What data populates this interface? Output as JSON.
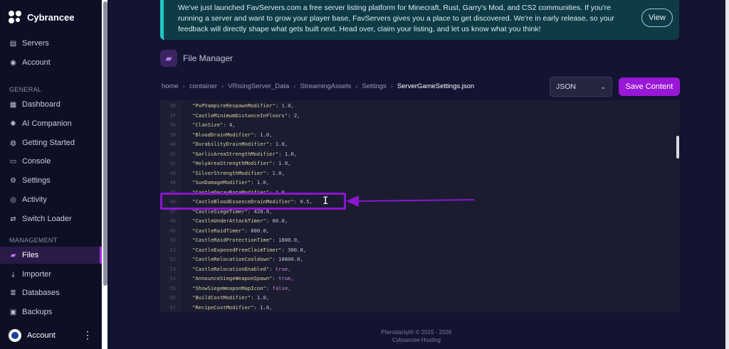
{
  "brand": {
    "name": "Cybrancee"
  },
  "sidebar": {
    "top_items": [
      {
        "label": "Servers",
        "icon": "server-icon"
      },
      {
        "label": "Account",
        "icon": "user-circle-icon"
      }
    ],
    "general_label": "GENERAL",
    "general_items": [
      {
        "label": "Dashboard",
        "icon": "dashboard-icon"
      },
      {
        "label": "AI Companion",
        "icon": "ai-icon"
      },
      {
        "label": "Getting Started",
        "icon": "globe-icon"
      },
      {
        "label": "Console",
        "icon": "console-icon"
      },
      {
        "label": "Settings",
        "icon": "gear-icon"
      },
      {
        "label": "Activity",
        "icon": "eye-icon"
      },
      {
        "label": "Switch Loader",
        "icon": "switch-icon"
      }
    ],
    "management_label": "MANAGEMENT",
    "management_items": [
      {
        "label": "Files",
        "icon": "folder-icon",
        "active": true
      },
      {
        "label": "Importer",
        "icon": "download-icon"
      },
      {
        "label": "Databases",
        "icon": "database-icon"
      },
      {
        "label": "Backups",
        "icon": "archive-icon"
      }
    ],
    "account_label": "Account"
  },
  "banner": {
    "text": "We've just launched FavServers.com a free server listing platform for Minecraft, Rust, Garry's Mod, and CS2 communities. If you're running a server and want to grow your player base, FavServers gives you a place to get discovered. We're in early release, so your feedback will directly shape what gets built next. Head over, claim your listing, and let us know what you think!",
    "button_label": "View"
  },
  "file_manager": {
    "title": "File Manager",
    "breadcrumb": [
      "home",
      "container",
      "VRisingServer_Data",
      "StreamingAssets",
      "Settings",
      "ServerGameSettings.json"
    ],
    "language_select": "JSON",
    "save_label": "Save Content"
  },
  "editor": {
    "lines": [
      {
        "num": "36",
        "key": "\"PvPVampireRespawnModifier\"",
        "val": "1.0,"
      },
      {
        "num": "37",
        "key": "\"CastleMinimumDistanceInFloors\"",
        "val": "2,"
      },
      {
        "num": "38",
        "key": "\"ClanSize\"",
        "val": "4,"
      },
      {
        "num": "39",
        "key": "\"BloodDrainModifier\"",
        "val": "1.0,"
      },
      {
        "num": "40",
        "key": "\"DurabilityDrainModifier\"",
        "val": "1.0,"
      },
      {
        "num": "41",
        "key": "\"GarlicAreaStrengthModifier\"",
        "val": "1.0,"
      },
      {
        "num": "42",
        "key": "\"HolyAreaStrengthModifier\"",
        "val": "1.0,"
      },
      {
        "num": "43",
        "key": "\"SilverStrengthModifier\"",
        "val": "1.0,"
      },
      {
        "num": "44",
        "key": "\"SunDamageModifier\"",
        "val": "1.0,"
      },
      {
        "num": "45",
        "key": "\"CastleDecayRateModifier\"",
        "val": "1.0,"
      },
      {
        "num": "46",
        "key": "\"CastleBloodEssenceDrainModifier\"",
        "val": "0.5,"
      },
      {
        "num": "47",
        "key": "\"CastleSiegeTimer\"",
        "val": "420.0,"
      },
      {
        "num": "48",
        "key": "\"CastleUnderAttackTimer\"",
        "val": "60.0,"
      },
      {
        "num": "49",
        "key": "\"CastleRaidTimer\"",
        "val": "600.0,"
      },
      {
        "num": "50",
        "key": "\"CastleRaidProtectionTime\"",
        "val": "1800.0,"
      },
      {
        "num": "51",
        "key": "\"CastleExposedFreeClaimTimer\"",
        "val": "300.0,"
      },
      {
        "num": "52",
        "key": "\"CastleRelocationCooldown\"",
        "val": "10800.0,"
      },
      {
        "num": "53",
        "key": "\"CastleRelocationEnabled\"",
        "val": "true,"
      },
      {
        "num": "54",
        "key": "\"AnnounceSiegeWeaponSpawn\"",
        "val": "true,"
      },
      {
        "num": "55",
        "key": "\"ShowSiegeWeaponMapIcon\"",
        "val": "false,"
      },
      {
        "num": "56",
        "key": "\"BuildCostModifier\"",
        "val": "1.0,"
      },
      {
        "num": "57",
        "key": "\"RecipeCostModifier\"",
        "val": "1.0,"
      }
    ],
    "highlight_color": "#8a16d0"
  },
  "footer": {
    "line1": "Pterodactyl® © 2015 - 2026",
    "line2": "Cybrancee Hosting"
  }
}
